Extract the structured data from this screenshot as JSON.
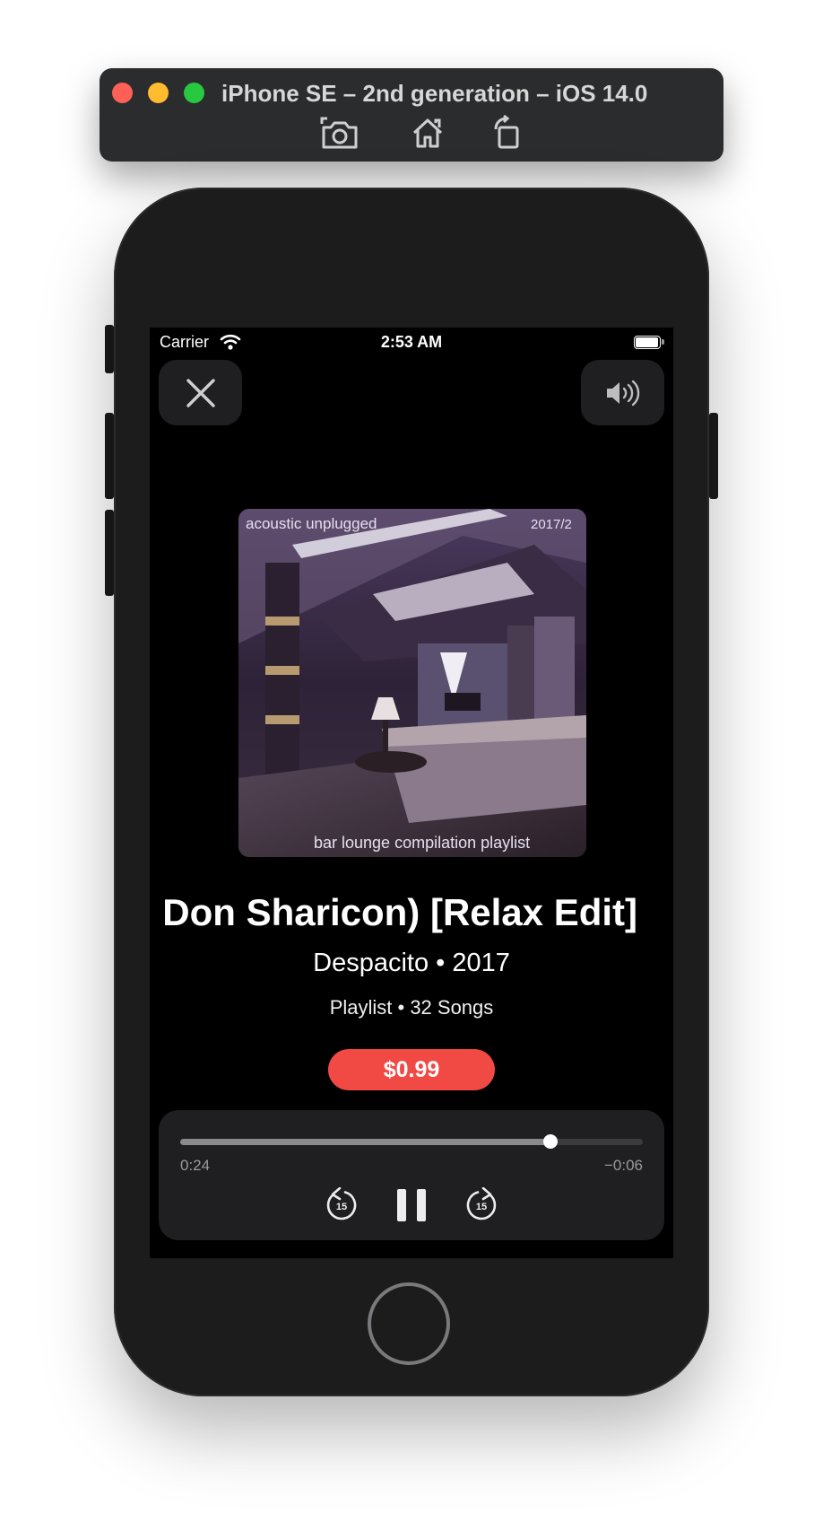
{
  "simulator": {
    "title": "iPhone SE – 2nd generation – iOS 14.0",
    "traffic_lights": [
      "#fe5f57",
      "#febc2e",
      "#28c840"
    ],
    "tools": [
      "screenshot-icon",
      "home-icon",
      "rotate-icon"
    ]
  },
  "status_bar": {
    "carrier": "Carrier",
    "time": "2:53 AM"
  },
  "header": {
    "close_icon": "close-icon",
    "volume_icon": "speaker-icon"
  },
  "now_playing": {
    "album_art_text_top_left": "acoustic unplugged",
    "album_art_text_top_right": "2017/2",
    "album_art_text_bottom": "bar lounge compilation playlist",
    "title": "Don Sharicon) [Relax Edit]",
    "subtitle": "Despacito • 2017",
    "meta": "Playlist • 32 Songs",
    "price": "$0.99",
    "accent_color": "#f14a45"
  },
  "player": {
    "elapsed": "0:24",
    "remaining": "−0:06",
    "progress": 0.8,
    "skip_back_seconds": "15",
    "skip_forward_seconds": "15",
    "state": "playing"
  }
}
